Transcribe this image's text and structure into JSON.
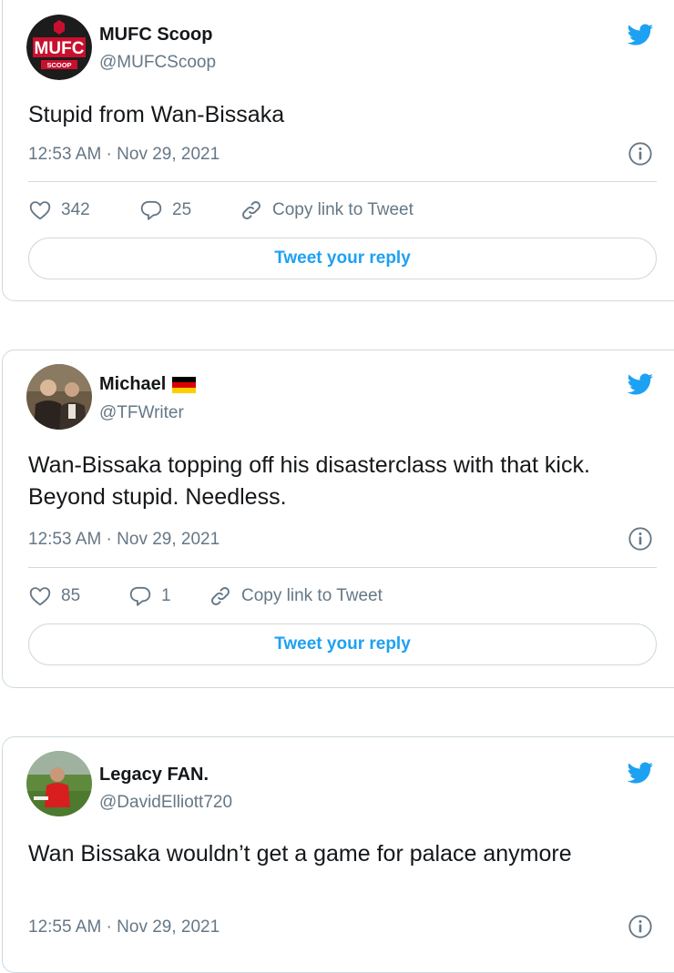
{
  "colors": {
    "accent": "#1da1f2",
    "text": "#14171a",
    "secondary": "#657786",
    "border": "#cfd9de"
  },
  "tweets": [
    {
      "author": {
        "name": "MUFC Scoop",
        "handle": "@MUFCScoop",
        "avatar_text": "MUFC",
        "avatar_subtext": "SCOOP"
      },
      "text": "Stupid from Wan-Bissaka",
      "timestamp": "12:53 AM · Nov 29, 2021",
      "likes": "342",
      "replies": "25",
      "copy_link_label": "Copy link to Tweet",
      "reply_label": "Tweet your reply"
    },
    {
      "author": {
        "name": "Michael",
        "handle": "@TFWriter",
        "flag_icon": "germany-flag-icon"
      },
      "text": "Wan-Bissaka topping off his disasterclass with that kick. Beyond stupid. Needless.",
      "timestamp": "12:53 AM · Nov 29, 2021",
      "likes": "85",
      "replies": "1",
      "copy_link_label": "Copy link to Tweet",
      "reply_label": "Tweet your reply"
    },
    {
      "author": {
        "name": "Legacy FAN.",
        "handle": "@DavidElliott720"
      },
      "text": "Wan Bissaka wouldn’t get a game for palace anymore",
      "timestamp": "12:55 AM · Nov 29, 2021"
    }
  ]
}
